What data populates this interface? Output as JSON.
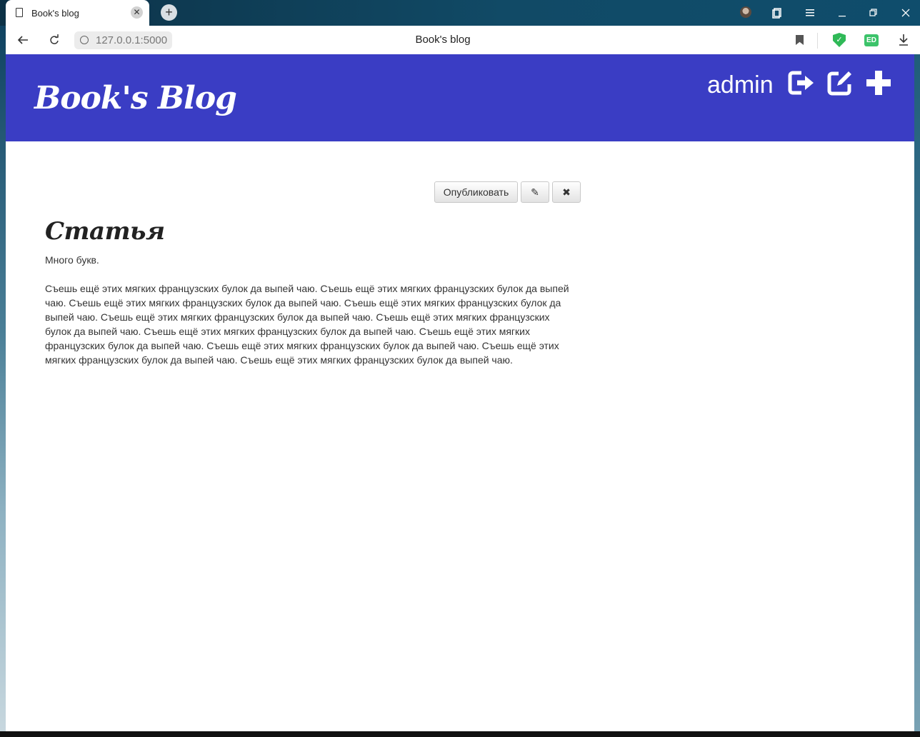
{
  "browser": {
    "tab_title": "Book's blog",
    "tab_close": "✕",
    "new_tab": "+",
    "url": "127.0.0.1:5000",
    "page_title": "Book's blog",
    "extension_label": "ED",
    "window_controls": [
      "minimize-icon",
      "restore-icon",
      "close-icon"
    ]
  },
  "site": {
    "brand": "Book's Blog",
    "username": "admin",
    "header_icons": [
      "logout-icon",
      "edit-icon",
      "plus-icon"
    ],
    "accent_color": "#3a3dc4"
  },
  "actions": {
    "publish_label": "Опубликовать",
    "edit_glyph": "✎",
    "delete_glyph": "✖"
  },
  "article": {
    "title": "Статья",
    "lead": "Много букв.",
    "body": "Съешь ещё этих мягких французских булок да выпей чаю. Съешь ещё этих мягких французских булок да выпей чаю. Съешь ещё этих мягких французских булок да выпей чаю. Съешь ещё этих мягких французских булок да выпей чаю. Съешь ещё этих мягких французских булок да выпей чаю. Съешь ещё этих мягких французских булок да выпей чаю. Съешь ещё этих мягких французских булок да выпей чаю. Съешь ещё этих мягких французских булок да выпей чаю. Съешь ещё этих мягких французских булок да выпей чаю. Съешь ещё этих мягких французских булок да выпей чаю. Съешь ещё этих мягких французских булок да выпей чаю."
  }
}
